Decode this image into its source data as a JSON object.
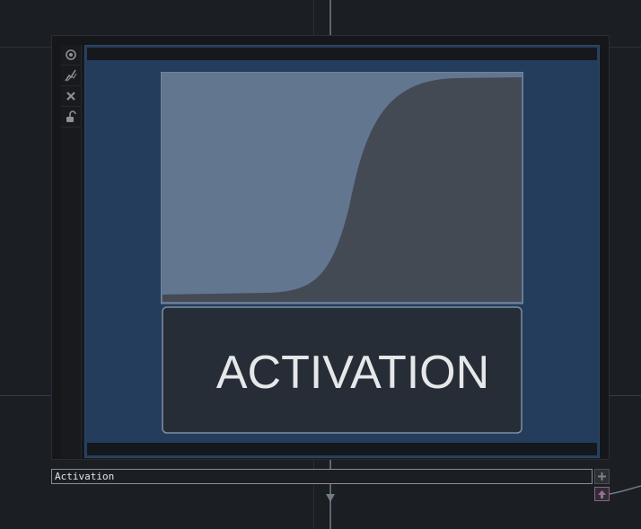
{
  "node": {
    "image_label": "ACTIVATION",
    "name_value": "Activation"
  },
  "toolbar": {
    "icons": [
      "eye-icon",
      "pulse-icon",
      "close-icon",
      "lock-icon"
    ]
  },
  "colors": {
    "background": "#1b1e23",
    "viewer_bg": "#243d5c",
    "curve_light": "#627690",
    "curve_dark": "#434a54",
    "label_bg": "#262d36",
    "label_text": "#e6e7e9",
    "connector_accent": "#a3699a"
  }
}
